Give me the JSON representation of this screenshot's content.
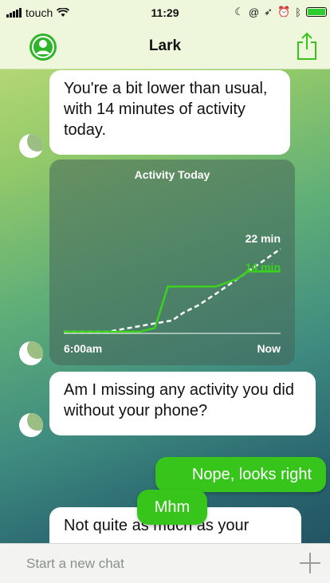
{
  "status_bar": {
    "carrier": "touch",
    "time": "11:29"
  },
  "nav": {
    "title": "Lark",
    "avatar_icon": "user-icon",
    "share_icon": "share-icon"
  },
  "messages": [
    {
      "from": "bot",
      "text": "You're a bit lower than usual, with 14 minutes of activity today."
    },
    {
      "from": "bot",
      "text": "Am I missing any activity you did without your phone?"
    },
    {
      "from": "user",
      "text": "Nope, looks right"
    },
    {
      "from": "bot",
      "text": "Not quite as much as your"
    },
    {
      "from": "user",
      "text": "Mhm"
    }
  ],
  "chart_data": {
    "type": "line",
    "title": "Activity Today",
    "x_start_label": "6:00am",
    "x_end_label": "Now",
    "ylim": [
      0,
      22
    ],
    "series": [
      {
        "value_label": "22 min",
        "style": "dashed",
        "color": "#ffffff",
        "points": [
          [
            0,
            0
          ],
          [
            0.1,
            0
          ],
          [
            0.2,
            0
          ],
          [
            0.3,
            1
          ],
          [
            0.4,
            2
          ],
          [
            0.5,
            3
          ],
          [
            0.55,
            5
          ],
          [
            0.62,
            7
          ],
          [
            0.7,
            10
          ],
          [
            0.8,
            14
          ],
          [
            0.9,
            18
          ],
          [
            1,
            22
          ]
        ]
      },
      {
        "value_label": "14 min",
        "style": "solid",
        "color": "#3bd11e",
        "points": [
          [
            0,
            0
          ],
          [
            0.1,
            0
          ],
          [
            0.2,
            0
          ],
          [
            0.35,
            0
          ],
          [
            0.42,
            1
          ],
          [
            0.48,
            12
          ],
          [
            0.55,
            12
          ],
          [
            0.7,
            12
          ],
          [
            0.8,
            14
          ],
          [
            0.85,
            16
          ],
          [
            0.9,
            16
          ],
          [
            1,
            16
          ]
        ]
      }
    ]
  },
  "input": {
    "placeholder": "Start a new chat"
  },
  "colors": {
    "accent": "#37c51c",
    "bar_bg": "#eef6dc"
  }
}
